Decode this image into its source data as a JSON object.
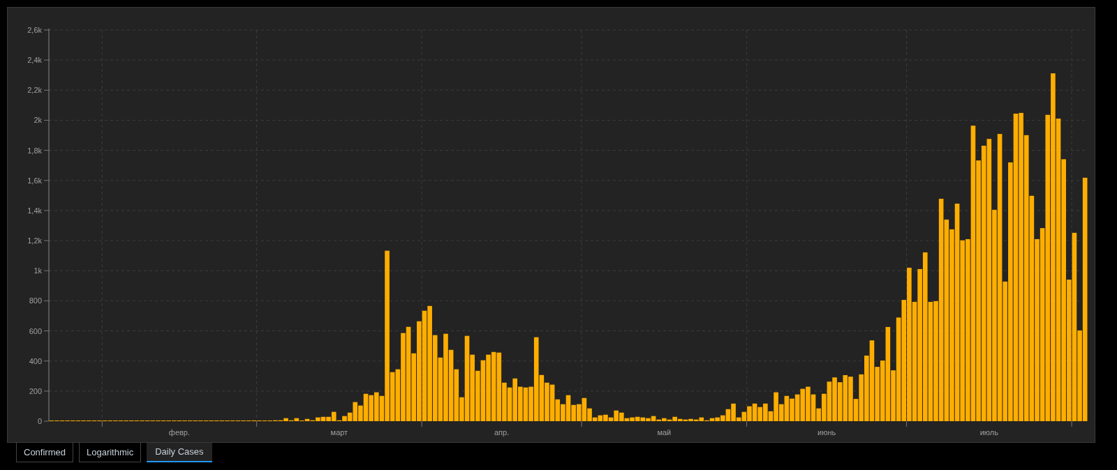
{
  "chart_panel": {
    "chart_data": {
      "type": "bar",
      "values": [
        0,
        0,
        0,
        0,
        0,
        0,
        0,
        0,
        0,
        0,
        0,
        0,
        0,
        0,
        0,
        0,
        0,
        0,
        0,
        0,
        0,
        0,
        0,
        0,
        0,
        0,
        0,
        0,
        0,
        0,
        0,
        0,
        0,
        0,
        0,
        0,
        0,
        0,
        5,
        3,
        2,
        3,
        6,
        6,
        20,
        6,
        20,
        2,
        15,
        6,
        25,
        29,
        29,
        62,
        6,
        34,
        57,
        127,
        104,
        182,
        173,
        192,
        168,
        1133,
        326,
        345,
        586,
        627,
        451,
        664,
        734,
        766,
        572,
        423,
        581,
        474,
        345,
        159,
        567,
        442,
        335,
        405,
        442,
        460,
        456,
        256,
        224,
        284,
        229,
        224,
        229,
        558,
        307,
        256,
        243,
        145,
        113,
        173,
        108,
        113,
        154,
        85,
        25,
        39,
        43,
        25,
        71,
        57,
        20,
        25,
        29,
        25,
        20,
        34,
        11,
        20,
        11,
        29,
        15,
        11,
        15,
        11,
        25,
        6,
        20,
        25,
        39,
        80,
        117,
        25,
        62,
        99,
        117,
        94,
        117,
        66,
        192,
        113,
        168,
        150,
        178,
        215,
        229,
        178,
        85,
        182,
        263,
        291,
        259,
        306,
        296,
        148,
        311,
        436,
        537,
        361,
        403,
        626,
        338,
        689,
        806,
        1020,
        793,
        1011,
        1122,
        793,
        798,
        1478,
        1340,
        1275,
        1446,
        1202,
        1210,
        1964,
        1733,
        1831,
        1876,
        1405,
        1909,
        928,
        1720,
        2044,
        2049,
        1901,
        1498,
        1210,
        1283,
        2036,
        2312,
        2011,
        1741,
        941,
        1252,
        603,
        1618
      ],
      "color": "#ffae00",
      "ylim": [
        0,
        2600
      ],
      "yticks": [
        {
          "value": 0,
          "label": "0"
        },
        {
          "value": 200,
          "label": "200"
        },
        {
          "value": 400,
          "label": "400"
        },
        {
          "value": 600,
          "label": "600"
        },
        {
          "value": 800,
          "label": "800"
        },
        {
          "value": 1000,
          "label": "1k"
        },
        {
          "value": 1200,
          "label": "1,2k"
        },
        {
          "value": 1400,
          "label": "1,4k"
        },
        {
          "value": 1600,
          "label": "1,6k"
        },
        {
          "value": 1800,
          "label": "1,8k"
        },
        {
          "value": 2000,
          "label": "2k"
        },
        {
          "value": 2200,
          "label": "2,2k"
        },
        {
          "value": 2400,
          "label": "2,4k"
        },
        {
          "value": 2600,
          "label": "2,6k"
        }
      ],
      "grid": true
    },
    "x_axis_labels": [
      "февр.",
      "март",
      "апр.",
      "май",
      "июнь",
      "июль"
    ]
  },
  "tabs": [
    {
      "label": "Confirmed",
      "selected": false
    },
    {
      "label": "Logarithmic",
      "selected": false
    },
    {
      "label": "Daily Cases",
      "selected": true
    }
  ]
}
